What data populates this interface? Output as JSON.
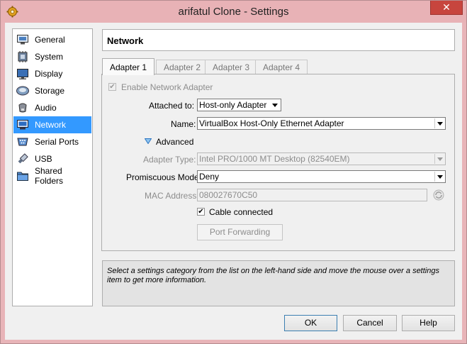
{
  "window": {
    "title": "arifatul Clone - Settings",
    "close_label": "✕"
  },
  "sidebar": {
    "items": [
      {
        "label": "General",
        "icon": "general-icon"
      },
      {
        "label": "System",
        "icon": "system-icon"
      },
      {
        "label": "Display",
        "icon": "display-icon"
      },
      {
        "label": "Storage",
        "icon": "storage-icon"
      },
      {
        "label": "Audio",
        "icon": "audio-icon"
      },
      {
        "label": "Network",
        "icon": "network-icon",
        "selected": true
      },
      {
        "label": "Serial Ports",
        "icon": "serial-ports-icon"
      },
      {
        "label": "USB",
        "icon": "usb-icon"
      },
      {
        "label": "Shared Folders",
        "icon": "shared-folders-icon"
      }
    ]
  },
  "header": {
    "title": "Network"
  },
  "tabs": [
    {
      "label": "Adapter 1",
      "active": true
    },
    {
      "label": "Adapter 2"
    },
    {
      "label": "Adapter 3"
    },
    {
      "label": "Adapter 4"
    }
  ],
  "adapter": {
    "enable_label": "Enable Network Adapter",
    "enable_checked": true,
    "attached_label": "Attached to:",
    "attached_value": "Host-only Adapter",
    "name_label": "Name:",
    "name_value": "VirtualBox Host-Only Ethernet Adapter",
    "advanced_label": "Advanced",
    "adapter_type_label": "Adapter Type:",
    "adapter_type_value": "Intel PRO/1000 MT Desktop (82540EM)",
    "promiscuous_label": "Promiscuous Mode:",
    "promiscuous_value": "Deny",
    "mac_label": "MAC Address:",
    "mac_value": "080027670C50",
    "cable_label": "Cable connected",
    "cable_checked": true,
    "port_forwarding_label": "Port Forwarding"
  },
  "info": {
    "text": "Select a settings category from the list on the left-hand side and move the mouse over a settings item to get more information."
  },
  "buttons": {
    "ok": "OK",
    "cancel": "Cancel",
    "help": "Help"
  },
  "colors": {
    "selection": "#3399ff",
    "titlebar": "#e8b2b6",
    "close": "#c7453e"
  }
}
